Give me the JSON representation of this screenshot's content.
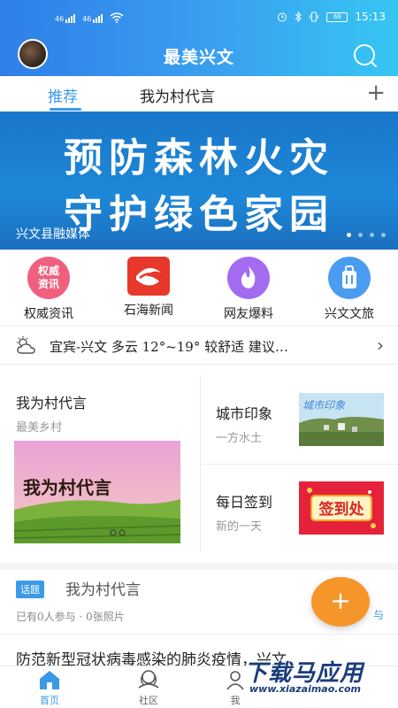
{
  "status_bar": {
    "signal_1": "46",
    "signal_2": "46",
    "battery": "68",
    "time": "15:13"
  },
  "header": {
    "title": "最美兴文"
  },
  "tabs": [
    {
      "label": "推荐",
      "active": true
    },
    {
      "label": "我为村代言",
      "active": false
    }
  ],
  "banner": {
    "line1": "预防森林火灾",
    "line2": "守护绿色家园",
    "source": "兴文县融媒体",
    "dots": 4,
    "active_dot": 0
  },
  "quick_entries": [
    {
      "label": "权威资讯",
      "icon": "authority-news-icon",
      "icon_text": [
        "权威",
        "资讯"
      ],
      "color": "#f0607e"
    },
    {
      "label": "石海新闻",
      "icon": "shihai-news-icon",
      "color": "#e8372b"
    },
    {
      "label": "网友爆料",
      "icon": "fire-icon",
      "color": "#a36cf0"
    },
    {
      "label": "兴文文旅",
      "icon": "luggage-icon",
      "color": "#4a9cf0"
    }
  ],
  "weather": {
    "text": "宜宾-兴文  多云  12°~19°  较舒适  建议…"
  },
  "feature": {
    "main": {
      "title": "我为村代言",
      "subtitle": "最美乡村",
      "image_text": "我为村代言"
    },
    "right": [
      {
        "title": "城市印象",
        "subtitle": "一方水土",
        "image_text": "城市印象"
      },
      {
        "title": "每日签到",
        "subtitle": "新的一天",
        "image_text": "签到处"
      }
    ]
  },
  "topic": {
    "badge": "话题",
    "title": "我为村代言",
    "meta": "已有0人参与  ·  0张照片",
    "join": "与"
  },
  "fab": {
    "label": "+"
  },
  "news": {
    "title": "防范新型冠状病毒感染的肺炎疫情，兴文"
  },
  "bottom_nav": [
    {
      "label": "首页",
      "active": true
    },
    {
      "label": "社区",
      "active": false
    },
    {
      "label": "我",
      "active": false
    }
  ],
  "watermark": {
    "big": "下载马应用",
    "small": "www.xiazaimao.com"
  },
  "colors": {
    "accent": "#3b9ae6",
    "fab": "#f6952a"
  }
}
